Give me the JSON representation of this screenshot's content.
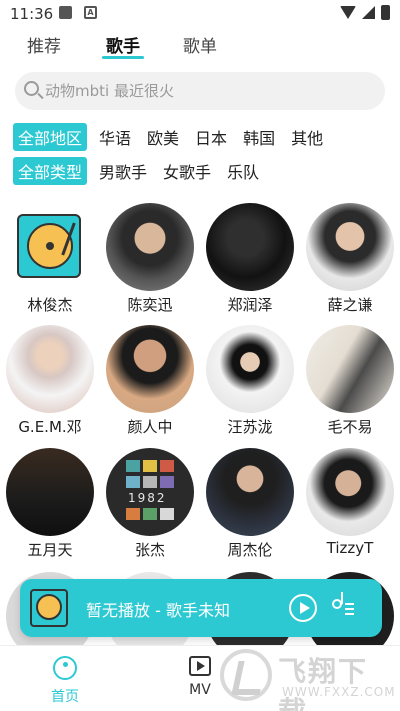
{
  "status_bar": {
    "time": "11:36"
  },
  "tabs": [
    {
      "label": "推荐",
      "active": false
    },
    {
      "label": "歌手",
      "active": true
    },
    {
      "label": "歌单",
      "active": false
    }
  ],
  "search": {
    "placeholder": "动物mbti 最近很火"
  },
  "filters": {
    "regions": [
      "全部地区",
      "华语",
      "欧美",
      "日本",
      "韩国",
      "其他"
    ],
    "types": [
      "全部类型",
      "男歌手",
      "女歌手",
      "乐队"
    ]
  },
  "artists": [
    {
      "name": "林俊杰",
      "avatar": "turntable-placeholder"
    },
    {
      "name": "陈奕迅",
      "avatar": "photo"
    },
    {
      "name": "郑润泽",
      "avatar": "photo"
    },
    {
      "name": "薛之谦",
      "avatar": "photo"
    },
    {
      "name": "G.E.M.邓",
      "avatar": "photo"
    },
    {
      "name": "颜人中",
      "avatar": "photo"
    },
    {
      "name": "汪苏泷",
      "avatar": "photo"
    },
    {
      "name": "毛不易",
      "avatar": "photo"
    },
    {
      "name": "五月天",
      "avatar": "photo"
    },
    {
      "name": "张杰",
      "avatar": "photo"
    },
    {
      "name": "周杰伦",
      "avatar": "photo"
    },
    {
      "name": "TizzyT",
      "avatar": "photo"
    }
  ],
  "album_tile_text": "1982",
  "player": {
    "title": "暂无播放 - 歌手未知"
  },
  "bottom_nav": [
    {
      "label": "首页",
      "active": true,
      "icon": "music-note-icon"
    },
    {
      "label": "MV",
      "active": false,
      "icon": "mv-play-icon"
    }
  ],
  "watermark": {
    "text": "飞翔下载",
    "url": "WWW.FXXZ.COM"
  },
  "colors": {
    "accent": "#2dc9d3",
    "text": "#222222",
    "search_bg": "#f1f1f1"
  }
}
